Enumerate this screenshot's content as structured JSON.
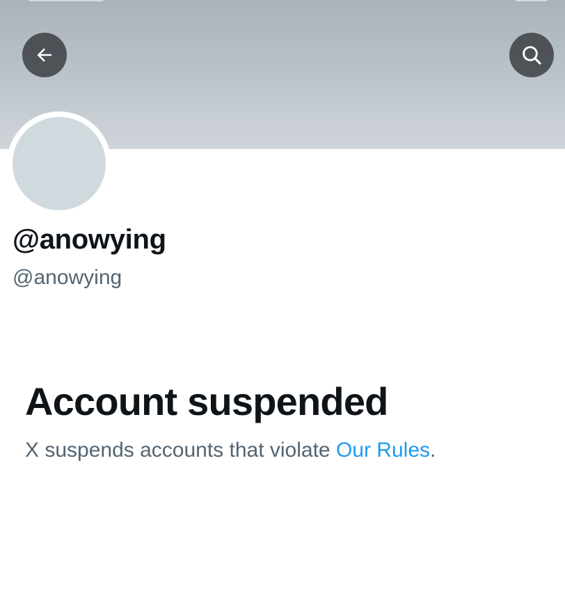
{
  "header": {
    "back_icon": "arrow-left-icon",
    "search_icon": "search-icon"
  },
  "profile": {
    "display_name": "@anowying",
    "handle": "@anowying"
  },
  "suspension": {
    "title": "Account suspended",
    "message_prefix": "X suspends accounts that violate ",
    "rules_link": "Our Rules",
    "message_suffix": "."
  },
  "colors": {
    "banner": "#b9c1c8",
    "avatar": "#cfd9de",
    "link": "#1d9bf0",
    "secondary_text": "#536471",
    "primary_text": "#0f1419"
  }
}
